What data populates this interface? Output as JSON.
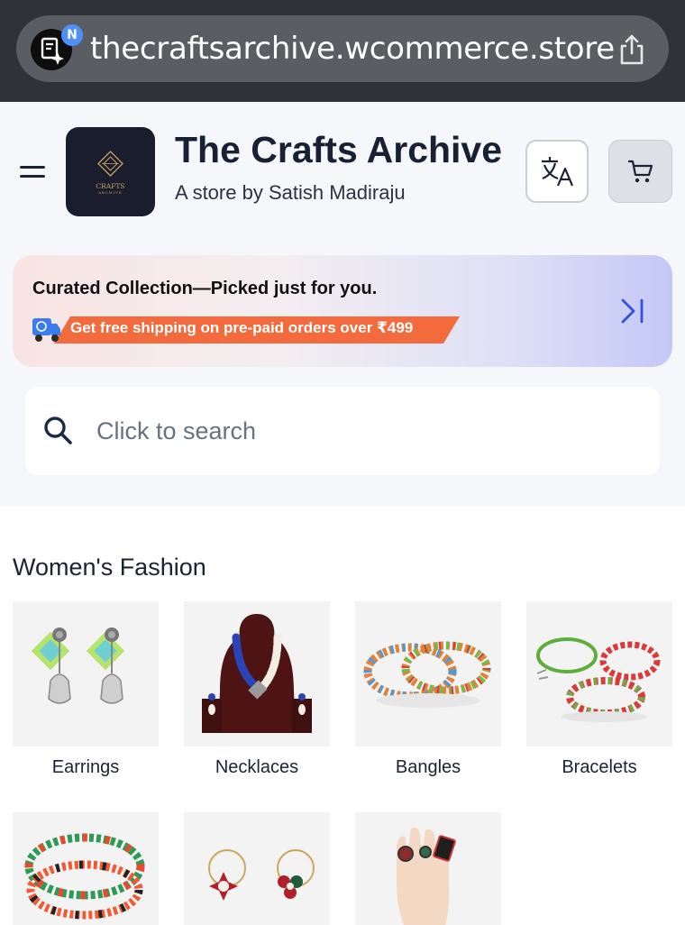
{
  "browser": {
    "url": "thecraftsarchive.wcommerce.store",
    "badge": "N"
  },
  "header": {
    "title": "The Crafts Archive",
    "subtitle": "A store by Satish Madiraju",
    "logo_text": "CRAFTS",
    "logo_subtext": "ARCHIVE"
  },
  "promo": {
    "title": "Curated Collection—Picked just for you.",
    "shipping": "Get free shipping on pre-paid orders over ₹499"
  },
  "search": {
    "placeholder": "Click to search"
  },
  "section": {
    "title": "Women's Fashion",
    "categories": [
      {
        "label": "Earrings",
        "icon": "earrings-image"
      },
      {
        "label": "Necklaces",
        "icon": "necklace-image"
      },
      {
        "label": "Bangles",
        "icon": "bangles-image"
      },
      {
        "label": "Bracelets",
        "icon": "bracelets-image"
      },
      {
        "label": "",
        "icon": "anklets-image"
      },
      {
        "label": "",
        "icon": "nose-pins-image"
      },
      {
        "label": "",
        "icon": "rings-image"
      }
    ]
  },
  "colors": {
    "accent": "#f36b3d",
    "title": "#182034",
    "browser_bg": "#2f3236"
  }
}
